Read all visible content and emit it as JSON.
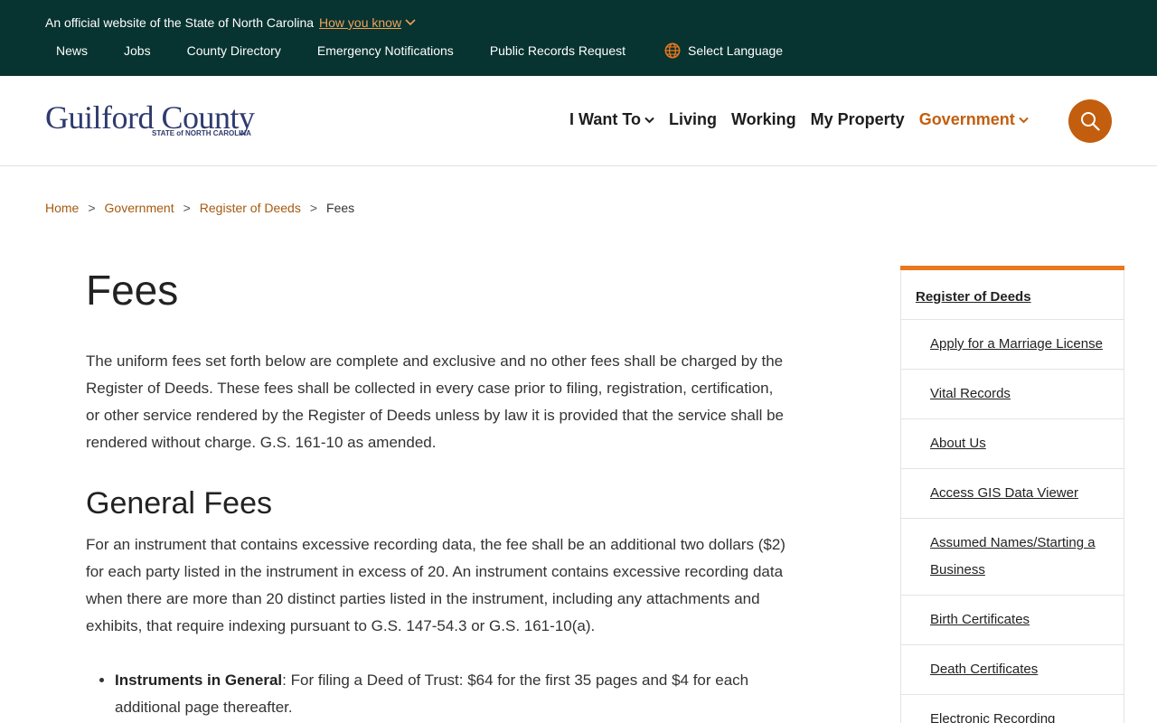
{
  "topbar": {
    "official_text": "An official website of the State of North Carolina",
    "how_you_know": "How you know",
    "links": [
      "News",
      "Jobs",
      "County Directory",
      "Emergency Notifications",
      "Public Records Request"
    ],
    "language": "Select Language"
  },
  "header": {
    "logo_main": "Guilford County",
    "logo_sub": "STATE of NORTH CAROLINA",
    "nav": [
      {
        "label": "I Want To",
        "dropdown": true
      },
      {
        "label": "Living"
      },
      {
        "label": "Working"
      },
      {
        "label": "My Property"
      },
      {
        "label": "Government",
        "dropdown": true,
        "active": true
      }
    ],
    "search_icon": "search-icon"
  },
  "breadcrumb": [
    "Home",
    "Government",
    "Register of Deeds",
    "Fees"
  ],
  "main": {
    "title": "Fees",
    "intro": "The uniform fees set forth below are complete and exclusive and no other fees shall be charged by the Register of Deeds. These fees shall be collected in every case prior to filing, registration, certification, or other service rendered by the Register of Deeds unless by law it is provided that the service shall be rendered without charge. G.S. 161-10 as amended.",
    "general_heading": "General Fees",
    "general_text": "For an instrument that contains excessive recording data, the fee shall be an additional two dollars ($2) for each party listed in the instrument in excess of 20. An instrument contains excessive recording data when there are more than 20 distinct parties listed in the instrument, including any attachments and exhibits, that require indexing pursuant to G.S. 147-54.3 or G.S. 161-10(a).",
    "list": [
      {
        "bold": "Instruments in General",
        "text": ": For filing a Deed of Trust: $64 for the first 35 pages and $4 for each additional page thereafter."
      }
    ]
  },
  "sidebar": {
    "heading": "Register of Deeds",
    "items": [
      "Apply for a Marriage License",
      "Vital Records",
      "About Us",
      "Access GIS Data Viewer",
      "Assumed Names/Starting a Business",
      "Birth Certificates",
      "Death Certificates",
      "Electronic Recording"
    ]
  },
  "colors": {
    "topbar_bg": "#073330",
    "accent": "#c25e0e",
    "sidebar_border": "#e8771d",
    "logo": "#2f3a6e"
  }
}
